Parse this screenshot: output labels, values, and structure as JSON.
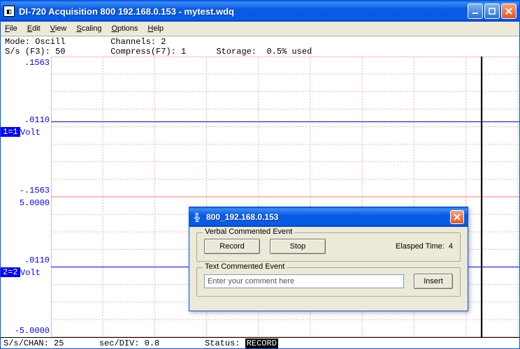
{
  "window": {
    "title": "DI-720 Acquisition 800 192.168.0.153 - mytest.wdq",
    "icon_glyph": "◧"
  },
  "menu": {
    "file": "File",
    "edit": "Edit",
    "view": "View",
    "scaling": "Scaling",
    "options": "Options",
    "help": "Help"
  },
  "status_top": {
    "line1": "Mode: Oscill         Channels: 2",
    "line2": "S/s (F3): 50         Compress(F7): 1      Storage:  0.5% used"
  },
  "chart_data": [
    {
      "type": "line",
      "channel_badge": "1=1",
      "unit": "Volt",
      "y_top": ".1563",
      "y_mid": ".0110",
      "y_bot": "-.1563",
      "ylim": [
        -0.1563,
        0.1563
      ],
      "trace_value": 0.011,
      "cursor_x_frac": 0.83
    },
    {
      "type": "line",
      "channel_badge": "2=2",
      "unit": "Volt",
      "y_top": "5.0000",
      "y_mid": ".0110",
      "y_bot": "-5.0000",
      "ylim": [
        -5.0,
        5.0
      ],
      "trace_value": 0.011,
      "cursor_x_frac": 0.83
    }
  ],
  "status_bottom": {
    "ss_chan": "S/s/CHAN: 25",
    "sec_div": "sec/DIV: 0.8",
    "status_label": "Status:",
    "status_value": "RECORD"
  },
  "dialog": {
    "title": "800_192.168.0.153",
    "verbal_legend": "Verbal Commented Event",
    "record_btn": "Record",
    "stop_btn": "Stop",
    "elapsed_label": "Elasped Time:",
    "elapsed_value": "4",
    "text_legend": "Text Commented Event",
    "text_placeholder": "Enter your comment here",
    "insert_btn": "Insert"
  }
}
